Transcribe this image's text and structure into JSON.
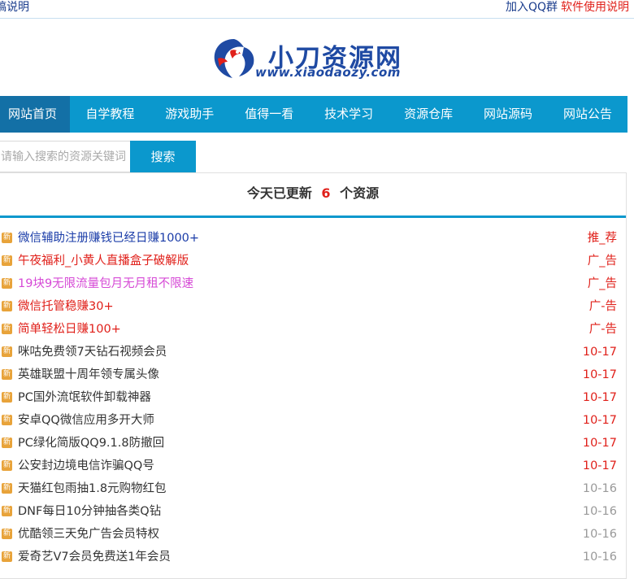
{
  "topbar": {
    "left_link": "稿说明",
    "qq_link": "加入QQ群",
    "manual_link": "软件使用说明"
  },
  "logo": {
    "cn": "小刀资源网",
    "en": "www.xiaodaozy.com"
  },
  "nav": [
    {
      "label": "网站首页",
      "active": true
    },
    {
      "label": "自学教程"
    },
    {
      "label": "游戏助手"
    },
    {
      "label": "值得一看"
    },
    {
      "label": "技术学习"
    },
    {
      "label": "资源仓库"
    },
    {
      "label": "网站源码"
    },
    {
      "label": "网站公告"
    }
  ],
  "search": {
    "placeholder": "请输入搜索的资源关键词",
    "button": "搜索"
  },
  "panel": {
    "prefix": "今天已更新",
    "count": "6",
    "suffix": "个资源"
  },
  "badge_text": "新",
  "items": [
    {
      "title": "微信辅助注册赚钱已经日赚1000+",
      "date": "推_荐",
      "title_color": "#1a3ca8",
      "date_color": "#e0201a"
    },
    {
      "title": "午夜福利_小黄人直播盒子破解版",
      "date": "广_告",
      "title_color": "#e0201a",
      "date_color": "#e0201a"
    },
    {
      "title": "19块9无限流量包月无月租不限速",
      "date": "广_告",
      "title_color": "#d64ad6",
      "date_color": "#e0201a"
    },
    {
      "title": "微信托管稳赚30+",
      "date": "广-告",
      "title_color": "#e0201a",
      "date_color": "#e0201a"
    },
    {
      "title": "简单轻松日赚100+",
      "date": "广-告",
      "title_color": "#e0201a",
      "date_color": "#e0201a"
    },
    {
      "title": "咪咕免费领7天钻石视频会员",
      "date": "10-17",
      "title_color": "#333333",
      "date_color": "#e0201a"
    },
    {
      "title": "英雄联盟十周年领专属头像",
      "date": "10-17",
      "title_color": "#333333",
      "date_color": "#e0201a"
    },
    {
      "title": "PC国外流氓软件卸载神器",
      "date": "10-17",
      "title_color": "#333333",
      "date_color": "#e0201a"
    },
    {
      "title": "安卓QQ微信应用多开大师",
      "date": "10-17",
      "title_color": "#333333",
      "date_color": "#e0201a"
    },
    {
      "title": "PC绿化简版QQ9.1.8防撤回",
      "date": "10-17",
      "title_color": "#333333",
      "date_color": "#e0201a"
    },
    {
      "title": "公安封边境电信诈骗QQ号",
      "date": "10-17",
      "title_color": "#333333",
      "date_color": "#e0201a"
    },
    {
      "title": "天猫红包雨抽1.8元购物红包",
      "date": "10-16",
      "title_color": "#333333",
      "date_color": "#999999"
    },
    {
      "title": "DNF每日10分钟抽各类Q钻",
      "date": "10-16",
      "title_color": "#333333",
      "date_color": "#999999"
    },
    {
      "title": "优酷领三天免广告会员特权",
      "date": "10-16",
      "title_color": "#333333",
      "date_color": "#999999"
    },
    {
      "title": "爱奇艺V7会员免费送1年会员",
      "date": "10-16",
      "title_color": "#333333",
      "date_color": "#999999"
    }
  ]
}
